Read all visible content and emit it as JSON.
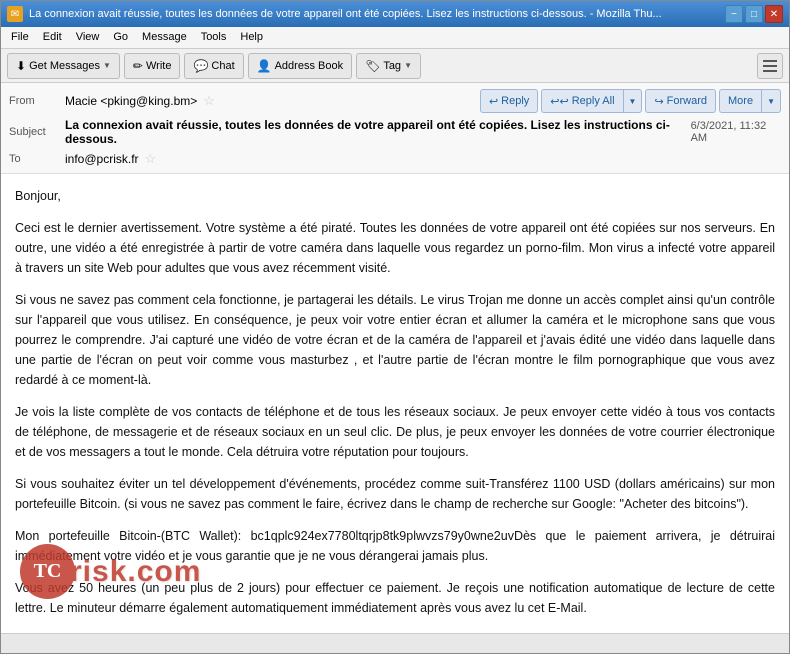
{
  "window": {
    "title": "La connexion avait réussie, toutes les données de votre appareil ont été copiées. Lisez les instructions ci-dessous. - Mozilla Thu...",
    "icon": "✉"
  },
  "title_buttons": {
    "minimize": "−",
    "maximize": "□",
    "close": "✕"
  },
  "menu": {
    "items": [
      "File",
      "Edit",
      "View",
      "Go",
      "Message",
      "Tools",
      "Help"
    ]
  },
  "toolbar": {
    "get_messages": "Get Messages",
    "write": "Write",
    "chat": "Chat",
    "address_book": "Address Book",
    "tag": "Tag",
    "get_messages_icon": "⬇",
    "write_icon": "✏",
    "chat_icon": "💬",
    "address_book_icon": "👤",
    "tag_icon": "🏷"
  },
  "message_header": {
    "from_label": "From",
    "from_value": "Macie <pking@king.bm>",
    "subject_label": "Subject",
    "subject_value": "La connexion avait réussie, toutes les données de votre appareil ont été copiées. Lisez les instructions ci-dessous.",
    "to_label": "To",
    "to_value": "info@pcrisk.fr",
    "date": "6/3/2021, 11:32 AM",
    "reply_btn": "Reply",
    "reply_all_btn": "Reply All",
    "forward_btn": "Forward",
    "more_btn": "More"
  },
  "message_body": {
    "paragraphs": [
      "Bonjour,",
      "Ceci est le dernier avertissement. Votre système a été piraté. Toutes les données de votre appareil ont été copiées sur nos serveurs. En outre, une vidéo a été enregistrée à partir de votre caméra dans laquelle vous regardez un porno-film. Mon virus a infecté votre appareil à travers un site Web pour adultes que vous avez récemment visité.",
      "Si vous ne savez pas comment cela fonctionne, je partagerai les détails. Le virus Trojan me donne un accès complet ainsi qu'un contrôle sur l'appareil que vous utilisez. En conséquence, je peux voir votre entier écran et allumer la caméra et le microphone sans que vous pourrez le comprendre. J'ai capturé une vidéo de votre écran et de la caméra de l'appareil et j'avais édité une vidéo dans laquelle dans une partie de l'écran on peut voir comme vous masturbez , et l'autre partie de l'écran montre le film pornographique que vous avez redardé à ce moment-là.",
      "Je vois la liste complète de vos contacts de téléphone et de tous les réseaux sociaux. Je peux envoyer cette vidéo à tous vos contacts de téléphone, de messagerie et de réseaux sociaux en un seul clic. De plus, je peux envoyer les données de votre courrier électronique et de vos messagers a tout le monde. Cela détruira votre réputation pour toujours.",
      "Si vous souhaitez éviter un tel développement d'événements, procédez comme suit-Transférez 1100 USD (dollars américains) sur mon portefeuille Bitcoin. (si vous ne savez pas comment le faire, écrivez dans le champ de recherche sur Google: \"Acheter des bitcoins\").",
      "Mon portefeuille Bitcoin-(BTC Wallet): bc1qplc924ex7780ltqrjp8tk9plwvzs79y0wne2uvDès que le paiement arrivera, je détruirai immédiatement votre vidéo et je vous garantie que je ne vous dérangerai jamais plus.",
      "Vous avez 50 heures (un peu plus de 2 jours) pour effectuer ce paiement. Je reçois une notification automatique de lecture de cette lettre. Le minuteur démarre également automatiquement immédiatement après vous avez lu cet E-Mail."
    ]
  },
  "watermark": {
    "text": "risk.com",
    "prefix": "PC"
  },
  "status_bar": {
    "text": ""
  }
}
